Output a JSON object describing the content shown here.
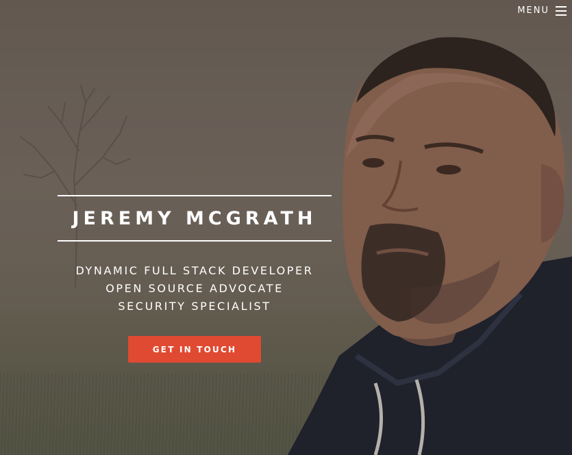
{
  "menu": {
    "label": "MENU",
    "icon": "hamburger-icon"
  },
  "hero": {
    "name": "JEREMY MCGRATH",
    "taglines": [
      "DYNAMIC FULL STACK DEVELOPER",
      "OPEN SOURCE ADVOCATE",
      "SECURITY SPECIALIST"
    ],
    "cta_label": "GET IN TOUCH"
  },
  "colors": {
    "accent": "#e04a32",
    "text": "#ffffff",
    "background": "#6a6058"
  }
}
